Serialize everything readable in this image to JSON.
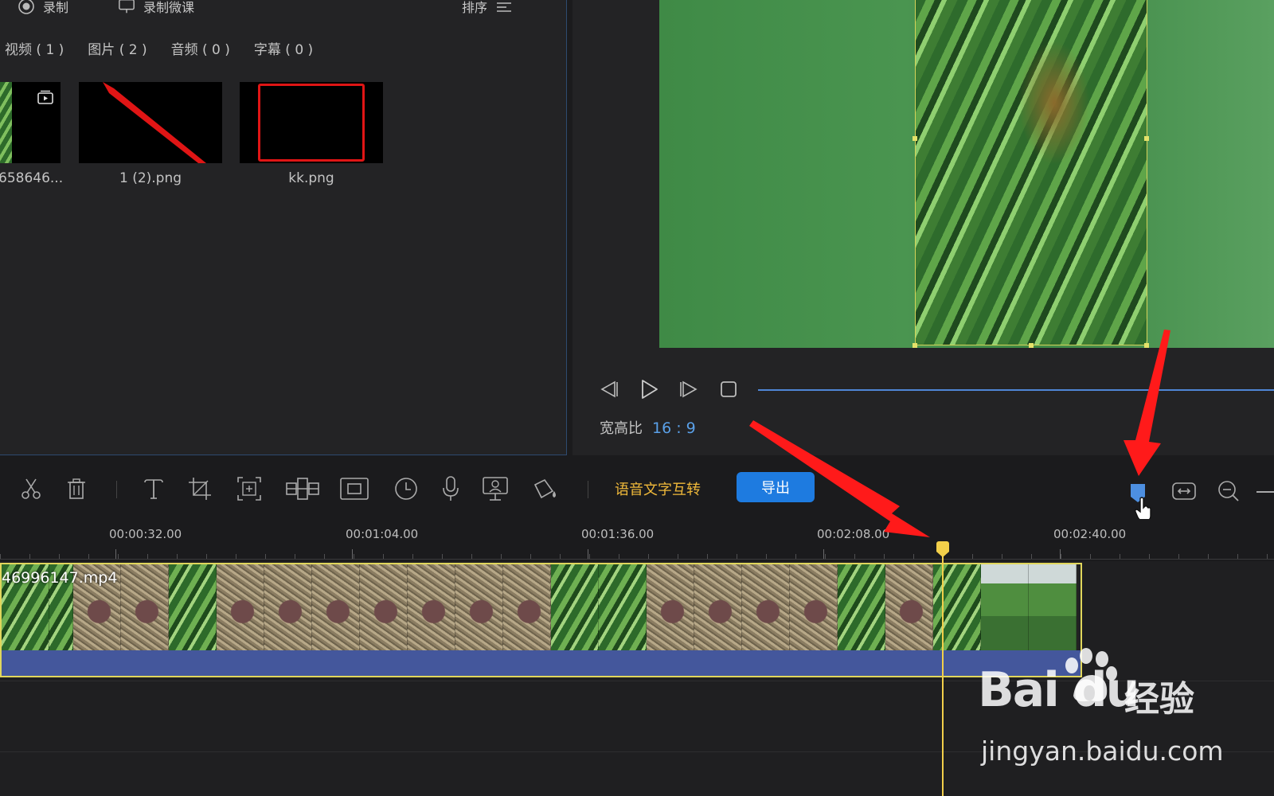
{
  "media_panel": {
    "record_label": "录制",
    "record_lesson_label": "录制微课",
    "sort_label": "排序",
    "tabs": [
      {
        "label": "视频 ( 1 )"
      },
      {
        "label": "图片 ( 2 )"
      },
      {
        "label": "音频 ( 0 )"
      },
      {
        "label": "字幕 ( 0 )"
      }
    ],
    "items": [
      {
        "label": "658646..."
      },
      {
        "label": "1 (2).png"
      },
      {
        "label": "kk.png"
      }
    ]
  },
  "preview": {
    "aspect_label": "宽高比",
    "aspect_value": "16 : 9"
  },
  "toolbar": {
    "icons": [
      "cut-icon",
      "delete-icon",
      "text-icon",
      "crop-icon",
      "zoom-frame-icon",
      "mosaic-icon",
      "freeze-frame-icon",
      "speed-icon",
      "voiceover-icon",
      "pip-icon",
      "fill-color-icon"
    ],
    "speech_to_text_label": "语音文字互转",
    "export_label": "导出"
  },
  "timeline": {
    "ticks": [
      "00:00:32.00",
      "00:01:04.00",
      "00:01:36.00",
      "00:02:08.00",
      "00:02:40.00"
    ],
    "clip_name": "46996147.mp4"
  },
  "watermark": {
    "brand": "Bai du",
    "jingyan": "经验",
    "url": "jingyan.baidu.com"
  },
  "colors": {
    "accent_blue": "#1e7be0",
    "playhead_yellow": "#f2cf4a",
    "speech_btn_text": "#f0b93a",
    "annotation_red": "#ff1a1a"
  }
}
